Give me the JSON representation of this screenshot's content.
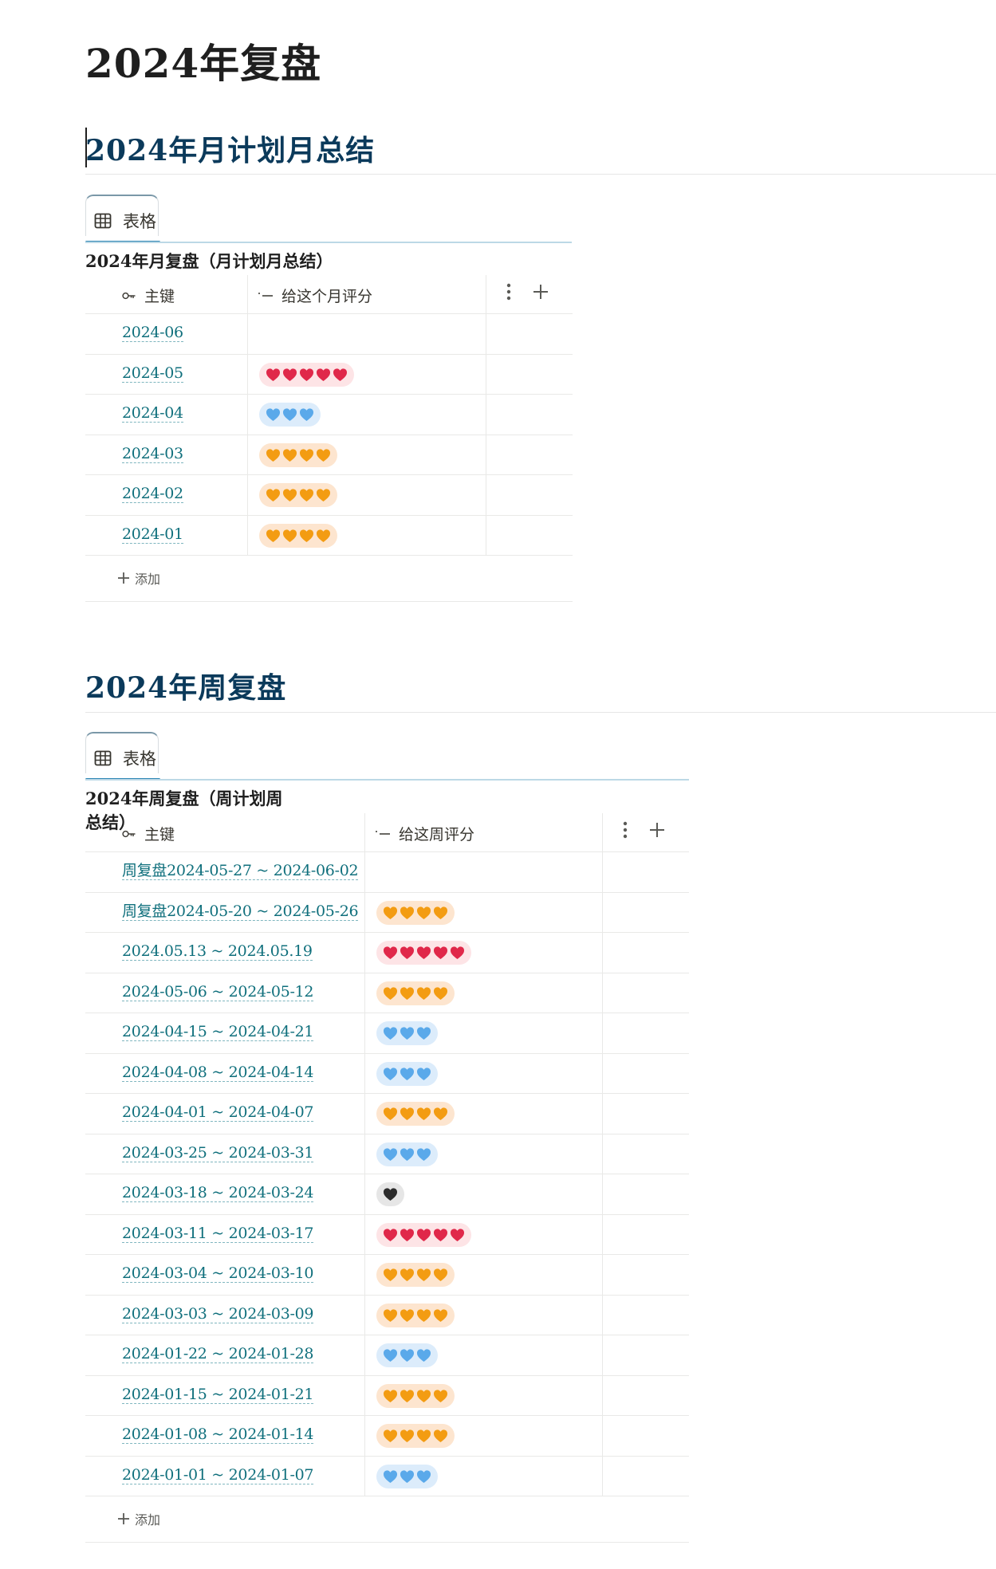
{
  "page": {
    "title": "2024年复盘"
  },
  "colors": {
    "heading": "#0b3a5b",
    "link": "#0f6f7c",
    "tab_underline": "#2e87b4",
    "red_heart": "#e0284a",
    "red_pill": "#fde4e6",
    "orange_heart": "#f39c12",
    "orange_pill": "#fde5cf",
    "blue_heart": "#5aa9ea",
    "blue_pill": "#dcecfb",
    "black_heart": "#2c2c2c",
    "black_pill": "#e6e6e6"
  },
  "monthly": {
    "heading": "2024年月计划月总结",
    "tab_label": "表格",
    "tab_icon": "table-icon",
    "db_title": "2024年月复盘（月计划月总结）",
    "col_key": "主键",
    "col_key_icon": "key-icon",
    "col_score": "给这个月评分",
    "col_score_icon": "text-icon",
    "add_label": "添加",
    "rows": [
      {
        "title": "2024-06",
        "rating": null,
        "count": 0
      },
      {
        "title": "2024-05",
        "rating": "red",
        "count": 5
      },
      {
        "title": "2024-04",
        "rating": "blue",
        "count": 3
      },
      {
        "title": "2024-03",
        "rating": "orange",
        "count": 4
      },
      {
        "title": "2024-02",
        "rating": "orange",
        "count": 4
      },
      {
        "title": "2024-01",
        "rating": "orange",
        "count": 4
      }
    ]
  },
  "weekly": {
    "heading": "2024年周复盘",
    "tab_label": "表格",
    "tab_icon": "table-icon",
    "db_title": "2024年周复盘（周计划周总结）",
    "col_key": "主键",
    "col_key_icon": "key-icon",
    "col_score": "给这周评分",
    "col_score_icon": "text-icon",
    "add_label": "添加",
    "rows": [
      {
        "title": "周复盘2024-05-27 ~ 2024-06-02",
        "rating": null,
        "count": 0
      },
      {
        "title": "周复盘2024-05-20 ~ 2024-05-26",
        "rating": "orange",
        "count": 4
      },
      {
        "title": "2024.05.13 ~ 2024.05.19",
        "rating": "red",
        "count": 5
      },
      {
        "title": "2024-05-06 ~ 2024-05-12",
        "rating": "orange",
        "count": 4
      },
      {
        "title": "2024-04-15 ~ 2024-04-21",
        "rating": "blue",
        "count": 3
      },
      {
        "title": "2024-04-08 ~ 2024-04-14",
        "rating": "blue",
        "count": 3
      },
      {
        "title": "2024-04-01 ~ 2024-04-07",
        "rating": "orange",
        "count": 4
      },
      {
        "title": "2024-03-25 ~ 2024-03-31",
        "rating": "blue",
        "count": 3
      },
      {
        "title": "2024-03-18 ~ 2024-03-24",
        "rating": "black",
        "count": 1
      },
      {
        "title": "2024-03-11 ~ 2024-03-17",
        "rating": "red",
        "count": 5
      },
      {
        "title": "2024-03-04 ~ 2024-03-10",
        "rating": "orange",
        "count": 4
      },
      {
        "title": "2024-03-03 ~ 2024-03-09",
        "rating": "orange",
        "count": 4
      },
      {
        "title": "2024-01-22 ~ 2024-01-28",
        "rating": "blue",
        "count": 3
      },
      {
        "title": "2024-01-15 ~ 2024-01-21",
        "rating": "orange",
        "count": 4
      },
      {
        "title": "2024-01-08 ~ 2024-01-14",
        "rating": "orange",
        "count": 4
      },
      {
        "title": "2024-01-01 ~ 2024-01-07",
        "rating": "blue",
        "count": 3
      }
    ]
  }
}
